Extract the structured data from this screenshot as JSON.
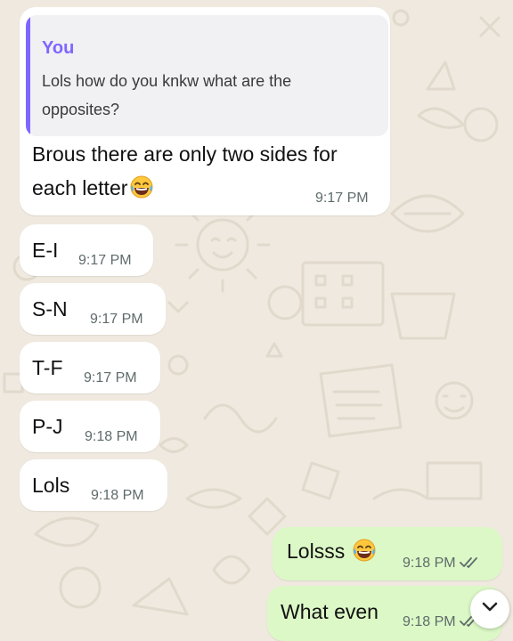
{
  "chat": {
    "messages": [
      {
        "direction": "incoming",
        "quote": {
          "author": "You",
          "text": "Lols how do you knkw what are the opposites?"
        },
        "text": "Brous there are only two sides for each letter",
        "emoji": "laughing-tears-emoji",
        "time": "9:17 PM"
      },
      {
        "direction": "incoming",
        "text": "E-I",
        "time": "9:17 PM"
      },
      {
        "direction": "incoming",
        "text": "S-N",
        "time": "9:17 PM"
      },
      {
        "direction": "incoming",
        "text": "T-F",
        "time": "9:17 PM"
      },
      {
        "direction": "incoming",
        "text": "P-J",
        "time": "9:18 PM"
      },
      {
        "direction": "incoming",
        "text": "Lols",
        "time": "9:18 PM"
      },
      {
        "direction": "outgoing",
        "text": "Lolsss",
        "emoji": "laughing-tears-emoji",
        "time": "9:18 PM",
        "status": "read-double-check-icon"
      },
      {
        "direction": "outgoing",
        "text": "What even",
        "time": "9:18 PM",
        "status": "read-double-check-icon"
      }
    ]
  },
  "scroll_button": {
    "icon": "chevron-down-icon"
  },
  "colors": {
    "wallpaper": "#efe9df",
    "incoming_bubble": "#ffffff",
    "outgoing_bubble": "#dcf8c6",
    "quote_accent": "#7f66ff",
    "timestamp": "#5f6b6b",
    "read_tick": "#5f6b6b"
  }
}
